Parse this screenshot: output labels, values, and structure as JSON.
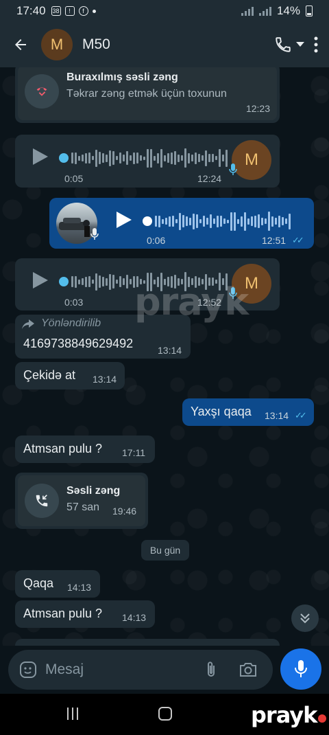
{
  "status_bar": {
    "time": "17:40",
    "battery": "14%",
    "notif_badge": "38"
  },
  "header": {
    "avatar_letter": "M",
    "contact_name": "M50"
  },
  "messages": {
    "missed_call": {
      "title": "Buraxılmış səsli zəng",
      "subtitle": "Təkrar zəng etmək üçün toxunun",
      "time": "12:23"
    },
    "voice1": {
      "duration": "0:05",
      "time": "12:24",
      "avatar_letter": "M"
    },
    "voice_out": {
      "duration": "0:06",
      "time": "12:51"
    },
    "voice2": {
      "duration": "0:03",
      "time": "12:52",
      "avatar_letter": "M"
    },
    "forwarded": {
      "label": "Yönləndirilib",
      "text": "4169738849629492",
      "time": "13:14"
    },
    "msg_cekide": {
      "text": "Çekidə at",
      "time": "13:14"
    },
    "msg_yaxsi": {
      "text": "Yaxşı qaqa",
      "time": "13:14"
    },
    "msg_atmsan1": {
      "text": "Atmsan pulu ?",
      "time": "17:11"
    },
    "voice_call": {
      "title": "Səsli zəng",
      "subtitle": "57 san",
      "time": "19:46"
    },
    "date_divider": "Bu gün",
    "msg_qaqa": {
      "text": "Qaqa",
      "time": "14:13"
    },
    "msg_atmsan2": {
      "text": "Atmsan pulu ?",
      "time": "14:13"
    }
  },
  "input": {
    "placeholder": "Mesaj"
  },
  "watermark": {
    "text": "prayk"
  },
  "colors": {
    "incoming": "#1f2c34",
    "outgoing": "#0d4a8c",
    "accent": "#1a73e8",
    "read_ticks": "#53bdeb"
  }
}
